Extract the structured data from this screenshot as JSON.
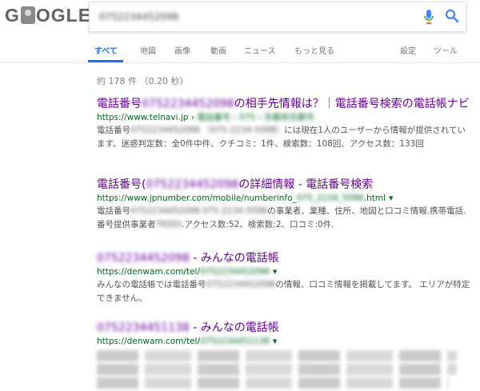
{
  "search": {
    "query": "0752234452098"
  },
  "tabs": [
    {
      "label": "すべて"
    },
    {
      "label": "地図"
    },
    {
      "label": "画像"
    },
    {
      "label": "動画"
    },
    {
      "label": "ニュース"
    },
    {
      "label": "もっと見る"
    },
    {
      "label": "設定"
    },
    {
      "label": "ツール"
    }
  ],
  "stats": "約 178 件 （0.20 秒）",
  "results": [
    {
      "title_pre": "電話番号",
      "title_hidden": "0752234452098",
      "title_post": "の相手先情報は？｜電話番号検索の電話帳ナビ",
      "url": "https://www.telnavi.jp",
      "url_sep": " › ",
      "url_hidden": "電話番号 › 075 › 京都府京都市",
      "snippet_pre": "電話番号",
      "snippet_hidden": "0752234452098 （075-2234-5098）",
      "snippet_post": "には現在1人のユーザーから情報が提供されています。迷惑判定数：全0件中件、クチコミ：1件、検索数：108回、アクセス数：133回"
    },
    {
      "title_pre": "電話番号(",
      "title_hidden": "0752234452098",
      "title_post": "の詳細情報 - 電話番号検索",
      "url_pre": "https://www.jpnumber.com/mobile/numberinfo_",
      "url_hidden": "075_2234_5098",
      "url_post": ".html",
      "snippet_pre": "電話番号",
      "snippet_hidden": "0752234452098 075-2234-5098",
      "snippet_mid": "の事業者、業種、住所、地図と口コミ情報.携帯電話.番号提供事業者",
      "snippet_hidden2": "TKDDI",
      "snippet_post": ".アクセス数:52、検索数:2、口コミ:0件."
    },
    {
      "title_hidden": "0752234452098",
      "title_post": " - みんなの電話帳",
      "url_pre": "https://denwam.com/tel/",
      "url_hidden": "0752234452098",
      "snippet_pre": "みんなの電話帳では電話番号",
      "snippet_hidden": "0752234452098",
      "snippet_post": "の情報、口コミ情報を掲載してます。 エリアが特定できません。"
    },
    {
      "title_hidden": "0752234451138",
      "title_post": " - みんなの電話帳",
      "url_pre": "https://denwam.com/tel/",
      "url_hidden": "0752234451138"
    }
  ],
  "colors": {
    "accent": "#1a73e8",
    "visited_title": "#660099",
    "url_green": "#006621",
    "snippet": "#545454"
  }
}
